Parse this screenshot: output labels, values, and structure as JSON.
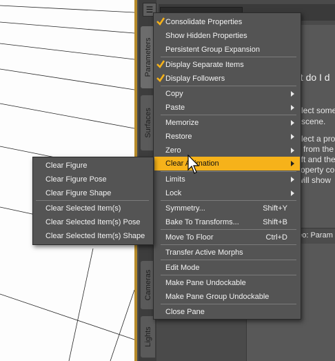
{
  "main_menu": {
    "items": [
      {
        "label": "Consolidate Properties",
        "checked": true
      },
      {
        "label": "Show Hidden Properties",
        "checked": false
      },
      {
        "label": "Persistent Group Expansion",
        "checked": false
      },
      {
        "label": "Display Separate Items",
        "checked": true
      },
      {
        "label": "Display Followers",
        "checked": true
      },
      {
        "label": "Copy",
        "submenu": true
      },
      {
        "label": "Paste",
        "submenu": true
      },
      {
        "label": "Memorize",
        "submenu": true
      },
      {
        "label": "Restore",
        "submenu": true
      },
      {
        "label": "Zero",
        "submenu": true
      },
      {
        "label": "Clear Animation",
        "submenu": true,
        "highlighted": true
      },
      {
        "label": "Limits",
        "submenu": true
      },
      {
        "label": "Lock",
        "submenu": true
      },
      {
        "label": "Symmetry...",
        "shortcut": "Shift+Y"
      },
      {
        "label": "Bake To Transforms...",
        "shortcut": "Shift+B"
      },
      {
        "label": "Move To Floor",
        "shortcut": "Ctrl+D"
      },
      {
        "label": "Transfer Active Morphs"
      },
      {
        "label": "Edit Mode"
      },
      {
        "label": "Make Pane Undockable"
      },
      {
        "label": "Make Pane Group Undockable"
      },
      {
        "label": "Close Pane"
      }
    ]
  },
  "sub_menu": {
    "items": [
      {
        "label": "Clear Figure"
      },
      {
        "label": "Clear Figure Pose"
      },
      {
        "label": "Clear Figure Shape"
      },
      {
        "label": "Clear Selected Item(s)"
      },
      {
        "label": "Clear Selected Item(s) Pose"
      },
      {
        "label": "Clear Selected Item(s) Shape"
      }
    ]
  },
  "tabs": {
    "parameters": "Parameters",
    "surfaces": "Surfaces",
    "cameras": "Cameras",
    "lights": "Lights"
  },
  "help": {
    "title_fragment": "at do I d",
    "lines": [
      "lect some",
      "scene.",
      "lect a pro",
      "p from the",
      "eft and the",
      "roperty co",
      "will show"
    ],
    "video_fragment": "deo: Param"
  },
  "colors": {
    "highlight": "#f6b21a",
    "check": "#f6b21a",
    "menu_bg": "#545454",
    "frame_accent": "#b58a2a"
  },
  "icons": {
    "pane_menu": "pane-menu-icon",
    "checkmark": "checkmark-icon",
    "submenu_arrow": "submenu-arrow-icon",
    "cursor": "mouse-cursor-icon"
  }
}
